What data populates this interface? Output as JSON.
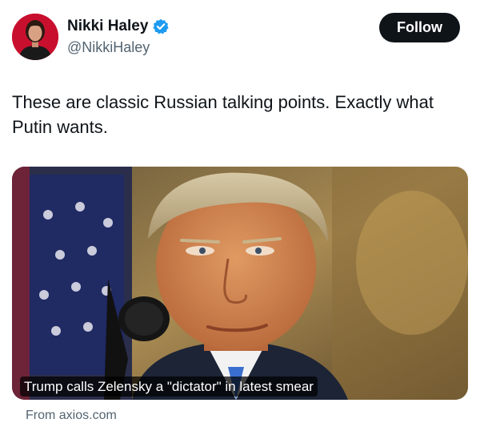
{
  "author": {
    "display_name": "Nikki Haley",
    "handle": "@NikkiHaley",
    "verified": true,
    "verified_color": "#1d9bf0"
  },
  "follow_button": {
    "label": "Follow"
  },
  "tweet": {
    "text": "These are classic Russian talking points. Exactly what Putin wants."
  },
  "link_card": {
    "headline": "Trump calls Zelensky a \"dictator\" in latest smear",
    "source": "From axios.com"
  },
  "icons": {
    "verified": "verified-badge-icon"
  },
  "colors": {
    "follow_bg": "#0f1419",
    "handle_text": "#536471",
    "avatar_bg": "#c8102e"
  }
}
